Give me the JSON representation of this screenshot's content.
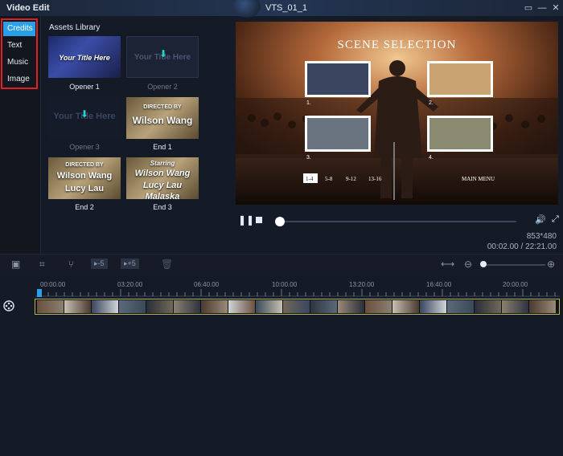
{
  "window": {
    "app_title": "Video Edit",
    "file_title": "VTS_01_1"
  },
  "sidebar": {
    "items": [
      {
        "label": "Credits",
        "active": true
      },
      {
        "label": "Text",
        "active": false
      },
      {
        "label": "Music",
        "active": false
      },
      {
        "label": "Image",
        "active": false
      }
    ]
  },
  "assets": {
    "title": "Assets Library",
    "items": [
      {
        "label": "Opener 1",
        "thumb_text": "Your Title Here",
        "dim": false
      },
      {
        "label": "Opener 2",
        "thumb_text": "Your Title Here",
        "dim": true
      },
      {
        "label": "Opener 3",
        "thumb_text": "Your Title Here",
        "dim": true
      },
      {
        "label": "End 1",
        "thumb_text_top": "DIRECTED BY",
        "thumb_text": "Wilson Wang",
        "dim": false
      },
      {
        "label": "End 2",
        "thumb_text_top": "DIRECTED BY",
        "thumb_text": "Wilson Wang",
        "thumb_text_2": "Lucy Lau",
        "dim": false
      },
      {
        "label": "End 3",
        "thumb_text_top": "Starring",
        "thumb_text": "Wilson Wang",
        "thumb_text_2": "Lucy Lau",
        "thumb_text_3": "Malaska",
        "dim": false
      }
    ]
  },
  "preview": {
    "scene_title": "SCENE SELECTION",
    "chapters": [
      "1.",
      "2.",
      "3.",
      "4."
    ],
    "nav": [
      "1-4",
      "5-8",
      "9-12",
      "13-16"
    ],
    "main_menu": "MAIN MENU",
    "resolution": "853*480",
    "time": "00:02.00 / 22:21.00",
    "progress": 0.03
  },
  "timeline": {
    "ticks": [
      "00:00.00",
      "03:20.00",
      "06:40.00",
      "10:00.00",
      "13:20.00",
      "16:40.00",
      "20:00.00"
    ]
  },
  "colors": {
    "accent": "#2aa0e8",
    "highlight_border": "#e02020",
    "track_border": "#b8b84a"
  }
}
